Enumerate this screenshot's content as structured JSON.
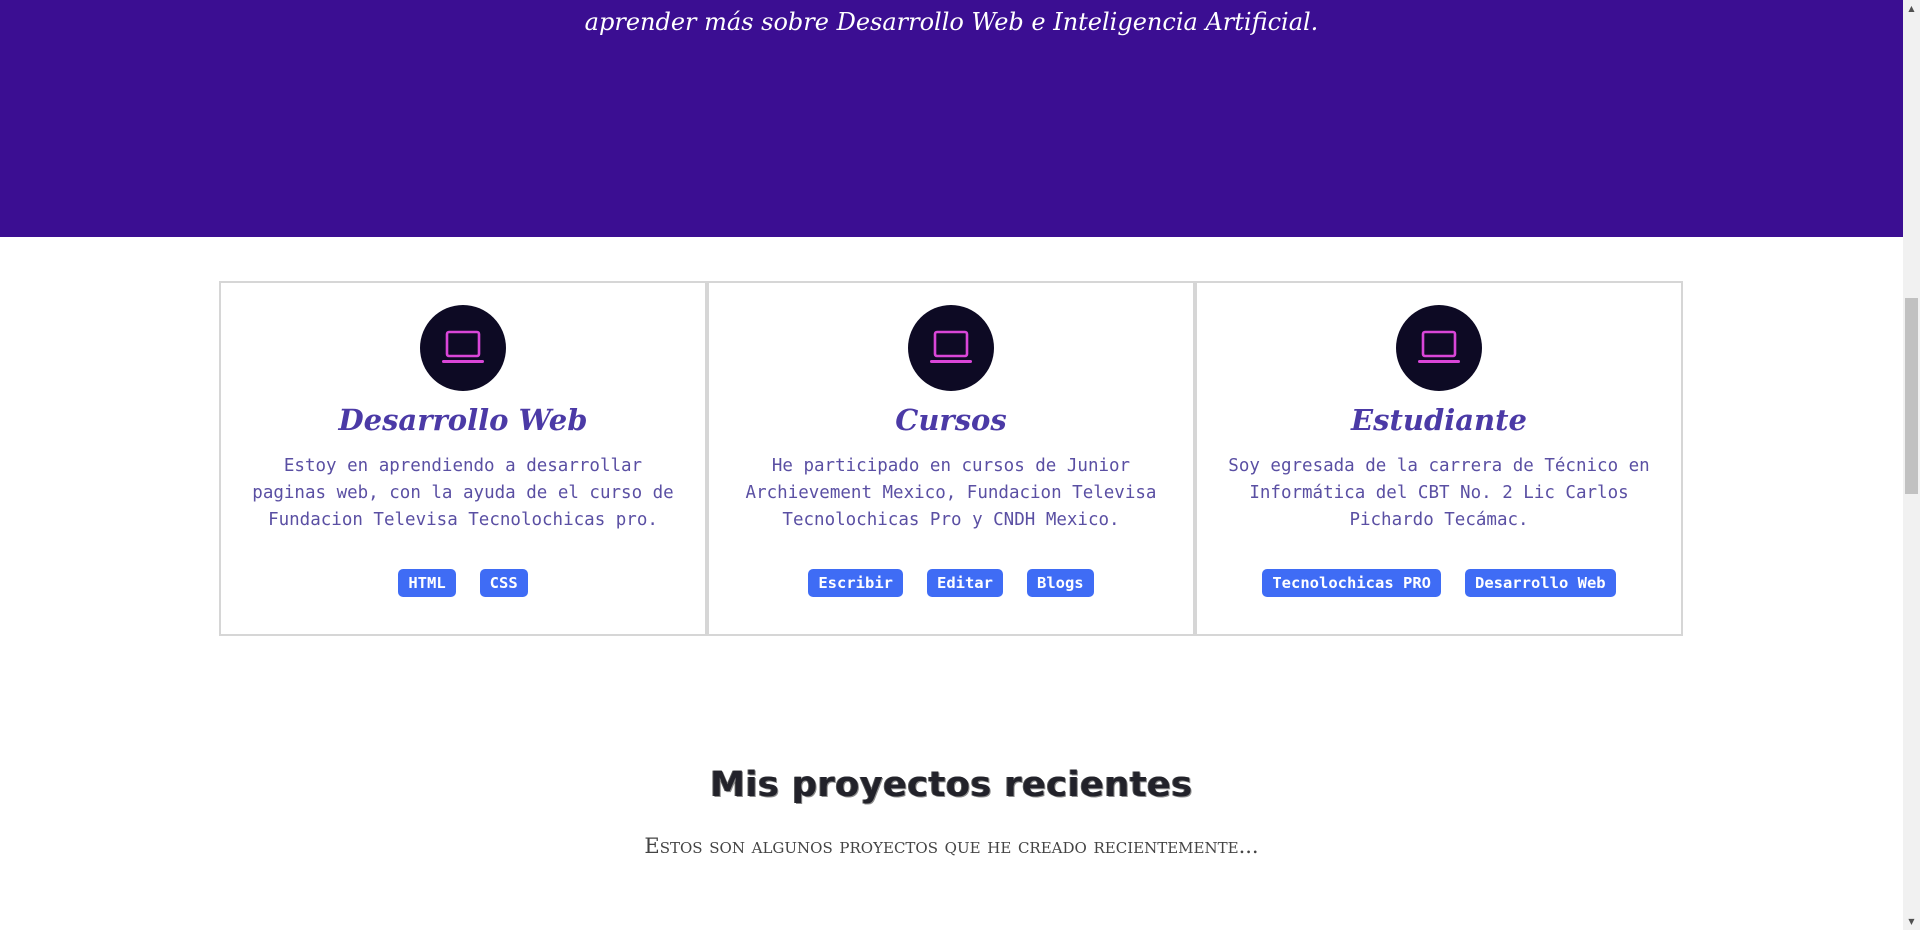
{
  "hero": {
    "text": "aprender más sobre Desarrollo Web e Inteligencia Artificial.",
    "background": "#3b0e92"
  },
  "cards": [
    {
      "icon": "laptop-icon",
      "title": "Desarrollo Web",
      "text": "Estoy en aprendiendo a desarrollar paginas web, con la ayuda de el curso de Fundacion Televisa Tecnolochicas pro.",
      "tags": [
        "HTML",
        "CSS"
      ]
    },
    {
      "icon": "laptop-icon",
      "title": "Cursos",
      "text": "He participado en cursos de Junior Archievement Mexico, Fundacion Televisa Tecnolochicas Pro y CNDH Mexico.",
      "tags": [
        "Escribir",
        "Editar",
        "Blogs"
      ]
    },
    {
      "icon": "laptop-icon",
      "title": "Estudiante",
      "text": "Soy egresada de la carrera de Técnico en Informática del CBT No. 2 Lic Carlos Pichardo Tecámac.",
      "tags": [
        "Tecnolochicas PRO",
        "Desarrollo Web"
      ]
    }
  ],
  "projects": {
    "title": "Mis proyectos recientes",
    "subtitle": "Estos son algunos proyectos que he creado recientemente..."
  },
  "colors": {
    "accent": "#3f6cf5",
    "title": "#4b3aa6",
    "icon_bg": "#0d0a24",
    "icon_fg": "#d946d8"
  }
}
